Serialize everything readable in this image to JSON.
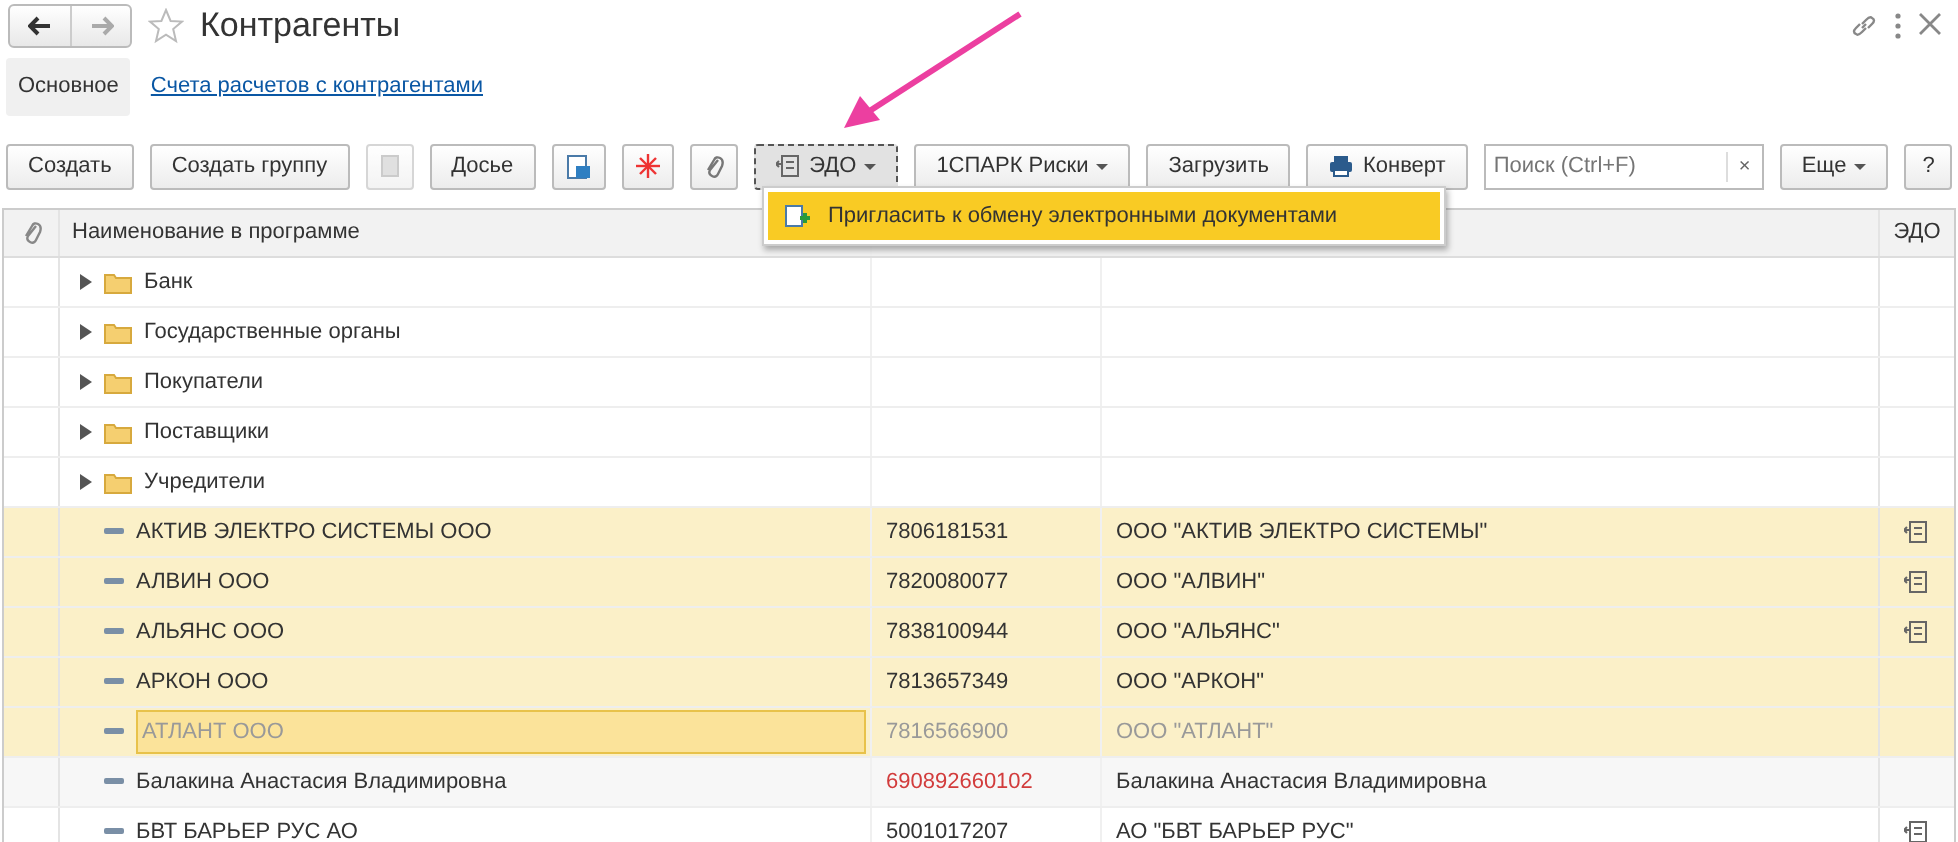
{
  "window": {
    "title": "Контрагенты",
    "favorite": false
  },
  "tabs": [
    {
      "label": "Основное",
      "selected": true
    },
    {
      "label": "Счета расчетов с контрагентами",
      "selected": false
    }
  ],
  "toolbar": [
    {
      "kind": "button",
      "label": "Создать"
    },
    {
      "kind": "button",
      "label": "Создать группу"
    },
    {
      "kind": "icon",
      "disabled": true
    },
    {
      "kind": "button",
      "label": "Досье"
    },
    {
      "kind": "icon"
    },
    {
      "kind": "icon"
    },
    {
      "kind": "icon"
    },
    {
      "kind": "menu",
      "label": "ЭДО",
      "pressed": true
    },
    {
      "kind": "menu",
      "label": "1СПАРК Риски"
    },
    {
      "kind": "button",
      "label": "Загрузить"
    },
    {
      "kind": "button",
      "label": "Конверт"
    },
    {
      "kind": "search",
      "placeholder": "Поиск (Ctrl+F)",
      "clear": "×"
    },
    {
      "kind": "menu",
      "label": "Еще"
    },
    {
      "kind": "button",
      "label": "?"
    }
  ],
  "dropdown": {
    "items": [
      {
        "label": "Пригласить к обмену электронными документами",
        "selected": true
      }
    ]
  },
  "table": {
    "columns": [
      "Наименование в программе",
      "ЭДО"
    ],
    "rows": [
      {
        "kind": "group",
        "name": "Банк"
      },
      {
        "kind": "group",
        "name": "Государственные органы"
      },
      {
        "kind": "group",
        "name": "Покупатели"
      },
      {
        "kind": "group",
        "name": "Поставщики"
      },
      {
        "kind": "group",
        "name": "Учредители"
      },
      {
        "kind": "item",
        "name": "АКТИВ ЭЛЕКТРО СИСТЕМЫ ООО",
        "inn": "7806181531",
        "full_name": "ООО \"АКТИВ ЭЛЕКТРО СИСТЕМЫ\"",
        "selected": true,
        "current": false,
        "edo": true,
        "inn_error": false
      },
      {
        "kind": "item",
        "name": "АЛВИН ООО",
        "inn": "7820080077",
        "full_name": "ООО \"АЛВИН\"",
        "selected": true,
        "current": false,
        "edo": true,
        "inn_error": false
      },
      {
        "kind": "item",
        "name": "АЛЬЯНС ООО",
        "inn": "7838100944",
        "full_name": "ООО \"АЛЬЯНС\"",
        "selected": true,
        "current": false,
        "edo": true,
        "inn_error": false
      },
      {
        "kind": "item",
        "name": "АРКОН ООО",
        "inn": "7813657349",
        "full_name": "ООО \"АРКОН\"",
        "selected": true,
        "current": false,
        "edo": false,
        "inn_error": false
      },
      {
        "kind": "item",
        "name": "АТЛАНТ ООО",
        "inn": "7816566900",
        "full_name": "ООО \"АТЛАНТ\"",
        "selected": true,
        "current": true,
        "edo": false,
        "inn_error": false
      },
      {
        "kind": "item",
        "name": "Балакина Анастасия Владимировна",
        "inn": "690892660102",
        "full_name": "Балакина Анастасия Владимировна",
        "selected": false,
        "current": false,
        "edo": false,
        "inn_error": true
      },
      {
        "kind": "item",
        "name": "БВТ БАРЬЕР РУС АО",
        "inn": "5001017207",
        "full_name": "АО \"БВТ БАРЬЕР РУС\"",
        "selected": false,
        "current": false,
        "edo": true,
        "inn_error": false
      }
    ]
  },
  "annotation": {
    "arrow": true
  }
}
